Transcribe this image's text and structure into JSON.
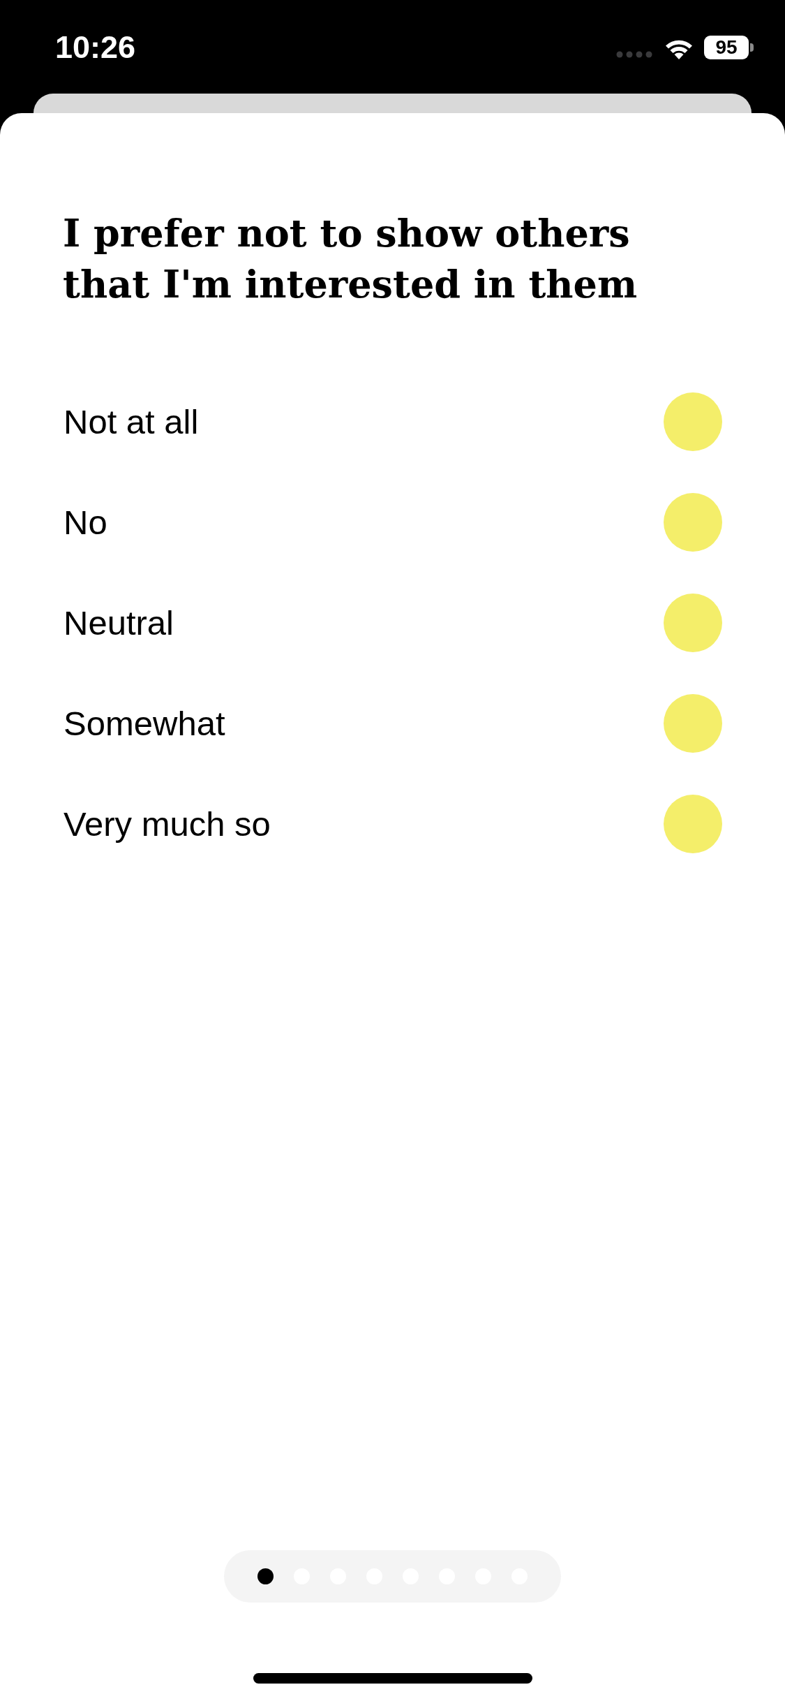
{
  "status_bar": {
    "time": "10:26",
    "battery": "95"
  },
  "question": {
    "title": "I prefer not to show others that I'm interested in them"
  },
  "options": [
    {
      "label": "Not at all",
      "selected": false
    },
    {
      "label": "No",
      "selected": false
    },
    {
      "label": "Neutral",
      "selected": false
    },
    {
      "label": "Somewhat",
      "selected": false
    },
    {
      "label": "Very much so",
      "selected": false
    }
  ],
  "pager": {
    "pages": [
      {
        "selected": true
      },
      {
        "selected": false
      },
      {
        "selected": false
      },
      {
        "selected": false
      },
      {
        "selected": false
      },
      {
        "selected": false
      },
      {
        "selected": false
      },
      {
        "selected": false
      }
    ]
  }
}
